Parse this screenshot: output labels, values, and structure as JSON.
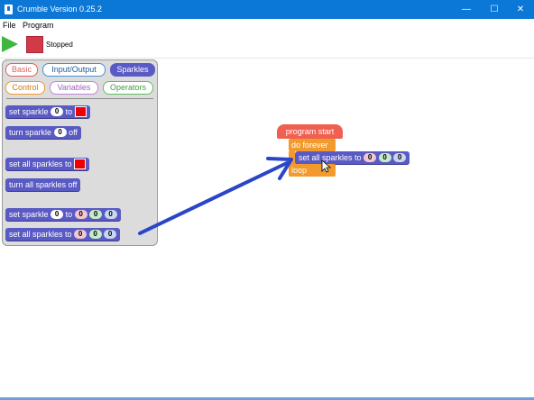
{
  "window": {
    "title": "Crumble Version 0.25.2",
    "controls": {
      "minimize": "—",
      "maximize": "☐",
      "close": "✕"
    }
  },
  "menu": {
    "file": "File",
    "program": "Program"
  },
  "toolbar": {
    "status": "Stopped"
  },
  "categories": [
    "Basic",
    "Input/Output",
    "Sparkles",
    "Control",
    "Variables",
    "Operators"
  ],
  "colors": {
    "basic": "#e06060",
    "io": "#4a90d0",
    "sparkles": "#5a5ac4",
    "control": "#f39a2c",
    "variables": "#c084d8",
    "operators": "#5fbf5f"
  },
  "palette_blocks": {
    "set_sparkle": {
      "text": "set sparkle",
      "index": "0",
      "to": "to"
    },
    "turn_sparkle": {
      "text": "turn sparkle",
      "index": "0",
      "off": "off"
    },
    "set_all_sparkles": {
      "text": "set all sparkles to"
    },
    "turn_all_off": {
      "text": "turn all sparkles off"
    },
    "set_sparkle_rgb": {
      "text": "set sparkle",
      "index": "0",
      "to": "to",
      "r": "0",
      "g": "0",
      "b": "0"
    },
    "set_all_rgb": {
      "text": "set all sparkles to",
      "r": "0",
      "g": "0",
      "b": "0"
    }
  },
  "workspace": {
    "start": "program start",
    "forever": "do forever",
    "set_all": {
      "text": "set all sparkles to",
      "r": "0",
      "g": "0",
      "b": "0"
    },
    "loop": "loop"
  },
  "annotation": {
    "arrow_color": "#2a45c8"
  }
}
